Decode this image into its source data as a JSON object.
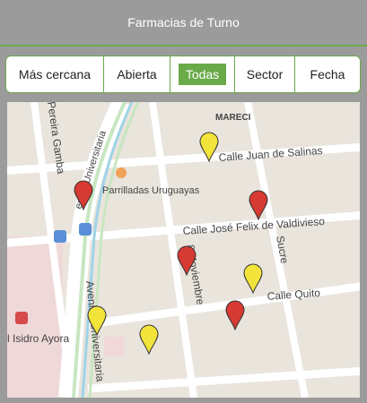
{
  "header": {
    "title": "Farmacias de Turno"
  },
  "filters": {
    "tabs": [
      {
        "label": "Más cercana"
      },
      {
        "label": "Abierta"
      },
      {
        "label": "Todas",
        "active": true
      },
      {
        "label": "Sector"
      },
      {
        "label": "Fecha"
      }
    ]
  },
  "map": {
    "labels": {
      "mareci": "MARECI",
      "calle_juan": "Calle Juan de Salinas",
      "parrilladas": "Parrilladas Uruguayas",
      "calle_jose": "Calle José Felix de Valdivieso",
      "calle_quito": "Calle Quito",
      "sucre": "Sucre",
      "noviembre": "8 Noviembre",
      "pereira": "Pereira Gamba",
      "universitaria_top": "enida Universitaria",
      "universitaria_bottom": "Avenida Universitaria",
      "hospital": "l Isidro Ayora"
    },
    "colors": {
      "red_pin": "#d63a32",
      "yellow_pin": "#f3e43c",
      "accent": "#6aaa48"
    },
    "pins": [
      {
        "color": "yellow",
        "name": "pin-yellow"
      },
      {
        "color": "red",
        "name": "pin-red"
      },
      {
        "color": "red",
        "name": "pin-red"
      },
      {
        "color": "red",
        "name": "pin-red"
      },
      {
        "color": "yellow",
        "name": "pin-yellow"
      },
      {
        "color": "red",
        "name": "pin-red"
      },
      {
        "color": "yellow",
        "name": "pin-yellow"
      },
      {
        "color": "yellow",
        "name": "pin-yellow"
      }
    ]
  }
}
